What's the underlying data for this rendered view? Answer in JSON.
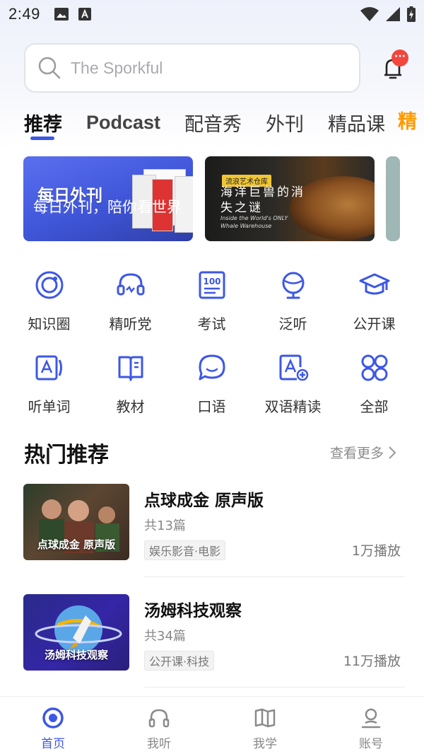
{
  "status_bar": {
    "time": "2:49"
  },
  "search": {
    "placeholder": "The Sporkful"
  },
  "notifications": {
    "badge": "···"
  },
  "tabs": [
    {
      "label": "推荐",
      "active": true
    },
    {
      "label": "Podcast",
      "active": false
    },
    {
      "label": "配音秀",
      "active": false
    },
    {
      "label": "外刊",
      "active": false
    },
    {
      "label": "精品课",
      "active": false
    }
  ],
  "tab_promo": "精",
  "banners": [
    {
      "title": "每日外刊",
      "caption": "每日外刊，陪你看世界"
    },
    {
      "tag": "流浪艺术仓库",
      "title": "海洋巨兽的消失之谜",
      "subtitle": "Inside the World's ONLY Whale Warehouse"
    },
    {
      "title": ""
    }
  ],
  "categories": [
    {
      "label": "知识圈",
      "icon": "circle-target-icon"
    },
    {
      "label": "精听党",
      "icon": "headphones-icon"
    },
    {
      "label": "考试",
      "icon": "exam-100-icon"
    },
    {
      "label": "泛听",
      "icon": "globe-icon"
    },
    {
      "label": "公开课",
      "icon": "graduation-cap-icon"
    },
    {
      "label": "听单词",
      "icon": "word-card-icon"
    },
    {
      "label": "教材",
      "icon": "book-icon"
    },
    {
      "label": "口语",
      "icon": "chat-bubble-icon"
    },
    {
      "label": "双语精读",
      "icon": "bilingual-read-icon"
    },
    {
      "label": "全部",
      "icon": "grid-all-icon"
    }
  ],
  "hot_section": {
    "title": "热门推荐",
    "see_more": "查看更多"
  },
  "hot_items": [
    {
      "title": "点球成金 原声版",
      "count": "共13篇",
      "tag": "娱乐影音·电影",
      "plays": "1万播放",
      "thumb_caption": "点球成金  原声版"
    },
    {
      "title": "汤姆科技观察",
      "count": "共34篇",
      "tag": "公开课·科技",
      "plays": "11万播放",
      "thumb_caption": "汤姆科技观察"
    }
  ],
  "bottom_nav": [
    {
      "label": "首页",
      "icon": "home-icon",
      "active": true
    },
    {
      "label": "我听",
      "icon": "headphones-icon",
      "active": false
    },
    {
      "label": "我学",
      "icon": "open-book-icon",
      "active": false
    },
    {
      "label": "账号",
      "icon": "user-icon",
      "active": false
    }
  ],
  "colors": {
    "accent": "#3d57e6",
    "promo": "#ff9900",
    "badge": "#f0463e"
  }
}
